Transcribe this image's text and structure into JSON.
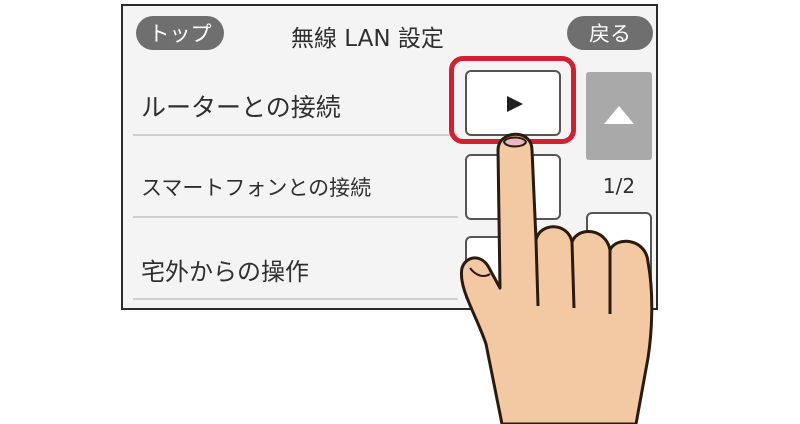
{
  "header": {
    "top_button": "トップ",
    "title": "無線 LAN 設定",
    "back_button": "戻る"
  },
  "menu": {
    "items": [
      {
        "label": "ルーターとの接続"
      },
      {
        "label": "スマートフォンとの接続"
      },
      {
        "label": "宅外からの操作"
      }
    ]
  },
  "scroll": {
    "page_indicator": "1/2"
  },
  "colors": {
    "highlight": "#d1202f",
    "pill": "#6f6f6f",
    "skin": "#f3c9a4"
  },
  "icons": {
    "play": "play-icon",
    "up": "triangle-up-icon",
    "down": "triangle-down-icon"
  }
}
